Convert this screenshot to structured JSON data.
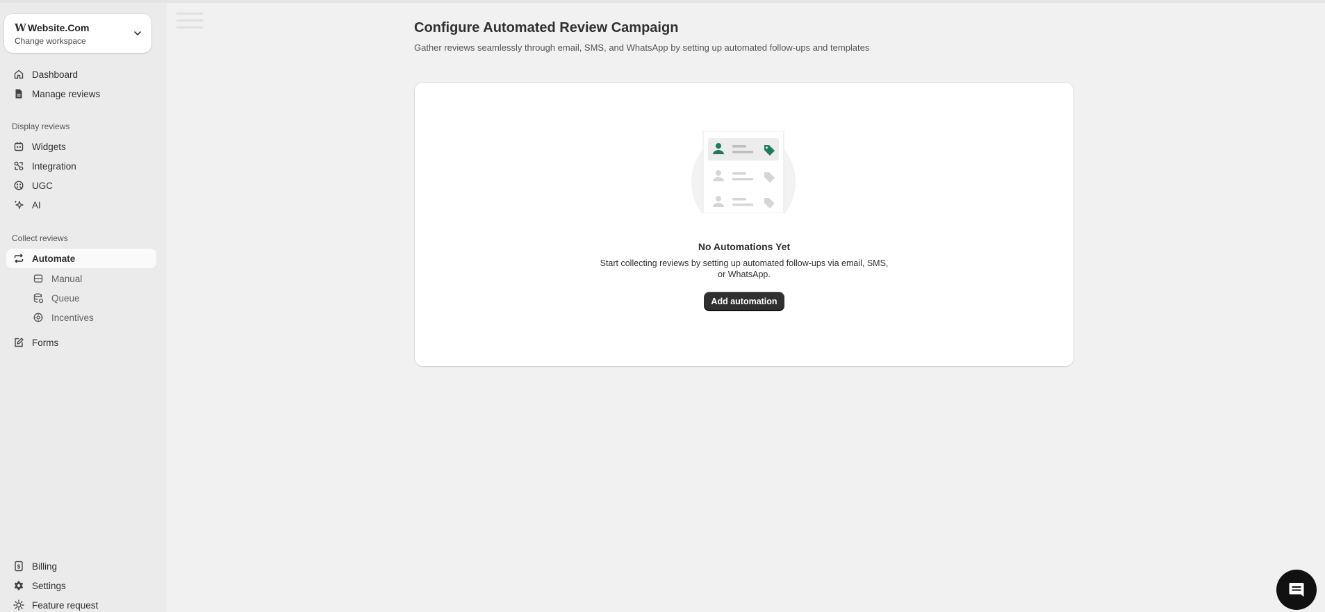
{
  "workspace": {
    "logo": "W",
    "name": "Website.Com",
    "change_label": "Change workspace"
  },
  "sidebar": {
    "top_items": [
      {
        "label": "Dashboard",
        "icon": "home-icon"
      },
      {
        "label": "Manage reviews",
        "icon": "document-icon"
      }
    ],
    "display_section": "Display reviews",
    "display_items": [
      {
        "label": "Widgets",
        "icon": "widgets-icon"
      },
      {
        "label": "Integration",
        "icon": "integration-icon"
      },
      {
        "label": "UGC",
        "icon": "ugc-icon"
      },
      {
        "label": "AI",
        "icon": "sparkle-icon"
      }
    ],
    "collect_section": "Collect reviews",
    "collect_items": [
      {
        "label": "Automate",
        "icon": "repeat-icon",
        "active": true
      },
      {
        "label": "Manual",
        "icon": "storage-icon"
      },
      {
        "label": "Queue",
        "icon": "database-icon"
      },
      {
        "label": "Incentives",
        "icon": "gear-cog-icon"
      },
      {
        "label": "Forms",
        "icon": "edit-form-icon"
      }
    ],
    "bottom_items": [
      {
        "label": "Billing",
        "icon": "billing-icon"
      },
      {
        "label": "Settings",
        "icon": "settings-icon"
      },
      {
        "label": "Feature request",
        "icon": "sun-icon"
      }
    ]
  },
  "main": {
    "title": "Configure Automated Review Campaign",
    "subtitle": "Gather reviews seamlessly through email, SMS, and WhatsApp by setting up automated follow-ups and templates",
    "empty_state": {
      "title": "No Automations Yet",
      "description": "Start collecting reviews by setting up automated follow-ups via email, SMS, or WhatsApp.",
      "button_label": "Add automation"
    }
  },
  "colors": {
    "accent_green": "#1f7a5a",
    "button_dark": "#303030",
    "sidebar_bg": "#ebebeb",
    "page_bg": "#f1f1f1"
  }
}
